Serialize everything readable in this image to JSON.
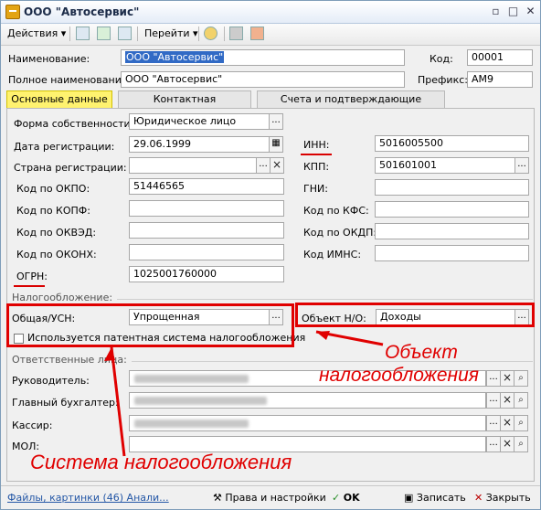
{
  "window": {
    "title": "ООО \"Автосервис\"",
    "controls": [
      "▫",
      "□",
      "✕"
    ]
  },
  "toolbar": {
    "actions": "Действия",
    "goto": "Перейти"
  },
  "header": {
    "name_label": "Наименование:",
    "name_value": "ООО \"Автосервис\"",
    "code_label": "Код:",
    "code_value": "00001",
    "full_name_label": "Полное наименование:",
    "full_name_value": "ООО \"Автосервис\"",
    "prefix_label": "Префикс:",
    "prefix_value": "АМ9"
  },
  "tabs": [
    "Основные данные",
    "Контактная информация",
    "Счета и подтверждающие документы"
  ],
  "main": {
    "form_label": "Форма собственности:",
    "form_value": "Юридическое лицо",
    "reg_date_label": "Дата регистрации:",
    "reg_date_value": "29.06.1999",
    "country_label": "Страна регистрации:",
    "country_value": "",
    "okpo_label": "Код по ОКПО:",
    "okpo_value": "51446565",
    "kopf_label": "Код по КОПФ:",
    "okved_label": "Код по ОКВЭД:",
    "okonh_label": "Код по ОКОНХ:",
    "ogrn_label": "ОГРН:",
    "ogrn_value": "1025001760000",
    "inn_label": "ИНН:",
    "inn_value": "5016005500",
    "kpp_label": "КПП:",
    "kpp_value": "501601001",
    "gni_label": "ГНИ:",
    "kfs_label": "Код по КФС:",
    "okdp_label": "Код по ОКДП:",
    "imns_label": "Код ИМНС:"
  },
  "tax": {
    "section": "Налогообложение:",
    "regime_label": "Общая/УСН:",
    "regime_value": "Упрощенная",
    "object_label": "Объект Н/О:",
    "object_value": "Доходы",
    "patent_label": "Используется патентная система налогообложения"
  },
  "responsible": {
    "section": "Ответственные лица:",
    "people": [
      "Руководитель:",
      "Главный бухгалтер:",
      "Кассир:",
      "МОЛ:"
    ]
  },
  "annotations": {
    "object": [
      "Объект",
      "налогообложения"
    ],
    "system": "Система налогообложения"
  },
  "footer": {
    "files_link": "Файлы, картинки (46) Анали...",
    "rights": "Права и настройки",
    "ok": "OK",
    "save": "Записать",
    "close": "Закрыть"
  }
}
